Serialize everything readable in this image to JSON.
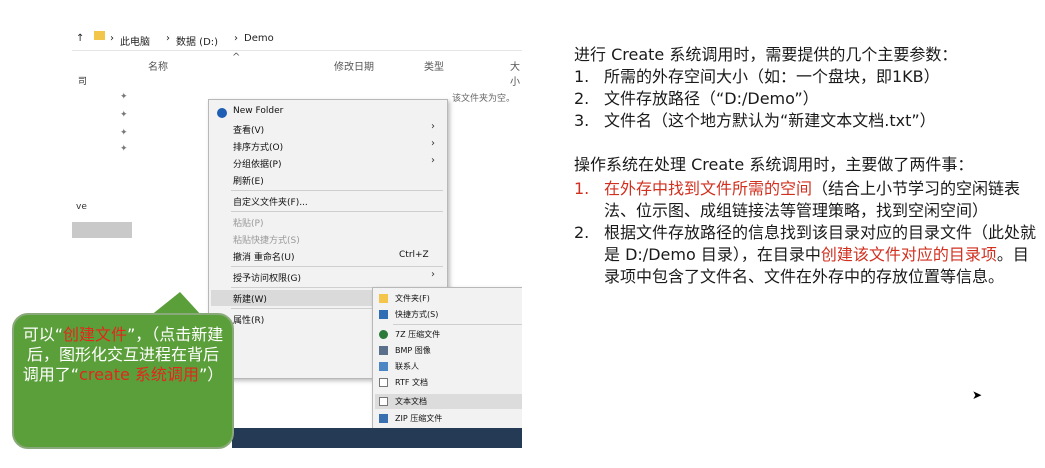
{
  "explorer": {
    "path": [
      "此电脑",
      "数据 (D:)",
      "Demo"
    ],
    "columns": [
      "名称",
      "修改日期",
      "类型",
      "大小"
    ],
    "empty_message": "该文件夹为空。",
    "sidebar": {
      "label_1": "司",
      "label_2": "ve"
    }
  },
  "context_menu": {
    "new_folder": "New Folder",
    "view": "查看(V)",
    "sort": "排序方式(O)",
    "group": "分组依据(P)",
    "refresh": "刷新(E)",
    "customize": "自定义文件夹(F)...",
    "paste": "粘贴(P)",
    "paste_shortcut": "粘贴快捷方式(S)",
    "undo_rename": "撤消 重命名(U)",
    "undo_shortcut": "Ctrl+Z",
    "give_access": "授予访问权限(G)",
    "new": "新建(W)",
    "properties": "属性(R)"
  },
  "submenu": {
    "folder": "文件夹(F)",
    "shortcut": "快捷方式(S)",
    "zip7": "7Z 压缩文件",
    "bmp": "BMP 图像",
    "contact": "联系人",
    "rtf": "RTF 文档",
    "text": "文本文档",
    "zip": "ZIP 压缩文件"
  },
  "callout": {
    "part1": "可以“",
    "highlight1": "创建文件",
    "part2": "”，（点击新建后，图形化交互进程在背后调用了“",
    "highlight2": "create 系统调用",
    "part3": "”）"
  },
  "panel": {
    "intro": "进行 Create 系统调用时，需要提供的几个主要参数：",
    "params": [
      {
        "num": "1.",
        "text": "所需的外存空间大小（如：一个盘块，即1KB）"
      },
      {
        "num": "2.",
        "text": "文件存放路径（“D:/Demo”）"
      },
      {
        "num": "3.",
        "text": "文件名（这个地方默认为“新建文本文档.txt”）"
      }
    ],
    "os_intro": "操作系统在处理 Create 系统调用时，主要做了两件事：",
    "step1": {
      "num": "1.",
      "highlight": "在外存中找到文件所需的空间",
      "rest": "（结合上小节学习的空闲链表法、位示图、成组链接法等管理策略，找到空闲空间）"
    },
    "step2": {
      "num": "2.",
      "part1": "根据文件存放路径的信息找到该目录对应的目录文件（此处就是 D:/Demo 目录），在目录中",
      "highlight": "创建该文件对应的目录项",
      "part2": "。目录项中包含了文件名、文件在外存中的存放位置等信息。"
    }
  },
  "colors": {
    "callout_bg": "#5b9f3a",
    "highlight_red": "#d2301f",
    "menu_bg": "#f2f2f2"
  }
}
